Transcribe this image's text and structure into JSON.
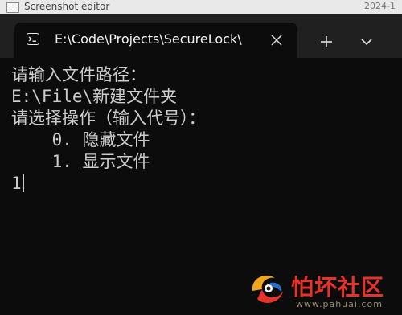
{
  "behind_window": {
    "title": "Screenshot editor",
    "right_text": "2024-1"
  },
  "tab": {
    "title": "E:\\Code\\Projects\\SecureLock\\"
  },
  "terminal": {
    "lines": [
      "请输入文件路径：",
      "E:\\File\\新建文件夹",
      "请选择操作（输入代号）：",
      "    0. 隐藏文件",
      "    1. 显示文件",
      "1"
    ]
  },
  "watermark": {
    "name": "怕坏社区",
    "url": "www.pahuai.com"
  },
  "colors": {
    "terminal_bg": "#0c0c0c",
    "tabstrip_bg": "#202020",
    "text": "#cccccc",
    "watermark_red": "#e4332b"
  }
}
